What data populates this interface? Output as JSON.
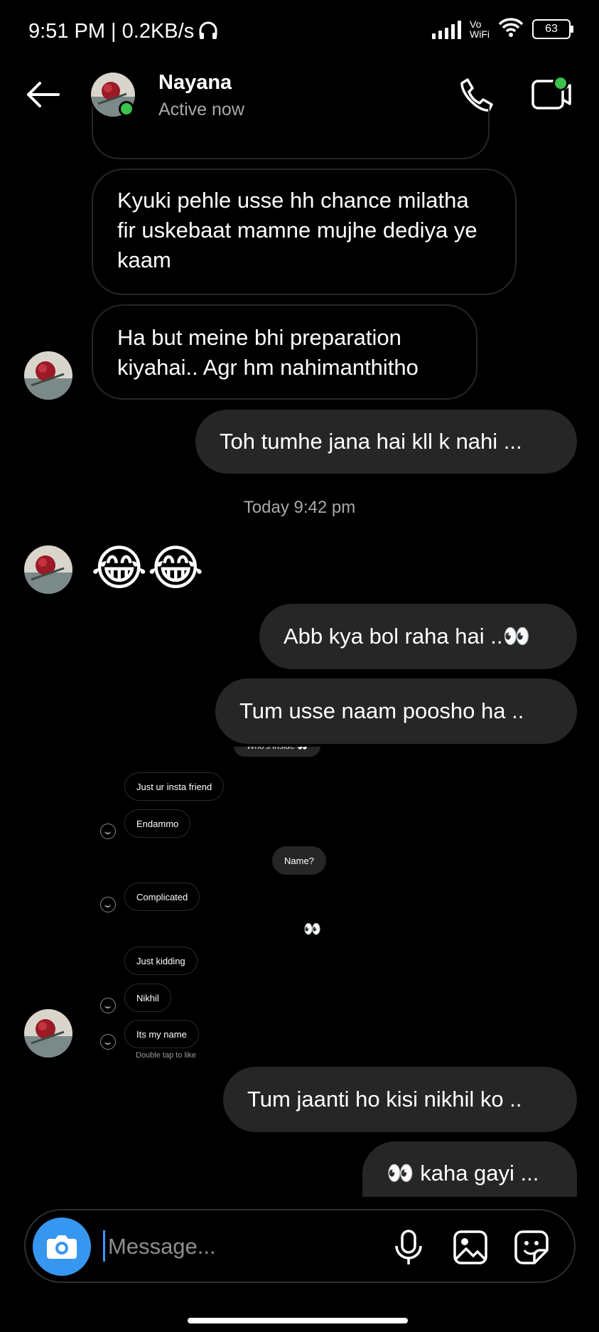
{
  "status_bar": {
    "time": "9:51 PM | 0.2KB/s",
    "network_label": "Vo\nWiFi",
    "battery": "63"
  },
  "header": {
    "name": "Nayana",
    "status": "Active now"
  },
  "messages": [
    {
      "id": "m1",
      "dir": "in",
      "text": "Kyuki pehle usse hh chance milatha fir uskebaat mamne mujhe dediya ye kaam"
    },
    {
      "id": "m2",
      "dir": "in",
      "text": "Ha but meine bhi preparation kiyahai.. Agr hm nahimanthitho"
    },
    {
      "id": "m3",
      "dir": "out",
      "text": "Toh tumhe jana hai kll k nahi ..."
    },
    {
      "id": "m4",
      "dir": "in",
      "text": "😂😂"
    },
    {
      "id": "m5",
      "dir": "out",
      "text": "Abb kya bol raha hai ..👀"
    },
    {
      "id": "m6",
      "dir": "out",
      "text": "Tum usse naam poosho ha .."
    },
    {
      "id": "m7",
      "dir": "out",
      "text": "Tum jaanti ho kisi nikhil ko .."
    },
    {
      "id": "m8",
      "dir": "out",
      "text": "👀 kaha gayi ..."
    }
  ],
  "timestamp": "Today 9:42 pm",
  "embedded_screenshot": {
    "cut_top": "Who's inside 👀",
    "items": [
      {
        "dir": "in",
        "text": "Just ur insta friend"
      },
      {
        "dir": "in",
        "text": "Endammo"
      },
      {
        "dir": "out",
        "text": "Name?"
      },
      {
        "dir": "in",
        "text": "Complicated"
      },
      {
        "dir": "out",
        "text": "👀"
      },
      {
        "dir": "in",
        "text": "Just kidding"
      },
      {
        "dir": "in",
        "text": "Nikhil"
      },
      {
        "dir": "in",
        "text": "Its my name"
      }
    ],
    "hint": "Double tap to like"
  },
  "composer": {
    "placeholder": "Message..."
  },
  "colors": {
    "background": "#000000",
    "incoming_border": "#262626",
    "outgoing_bubble": "#262626",
    "accent_blue": "#3797f0",
    "online_green": "#3ac34a"
  },
  "icons": [
    "back-arrow-icon",
    "phone-icon",
    "video-call-icon",
    "camera-icon",
    "microphone-icon",
    "gallery-icon",
    "sticker-icon"
  ]
}
